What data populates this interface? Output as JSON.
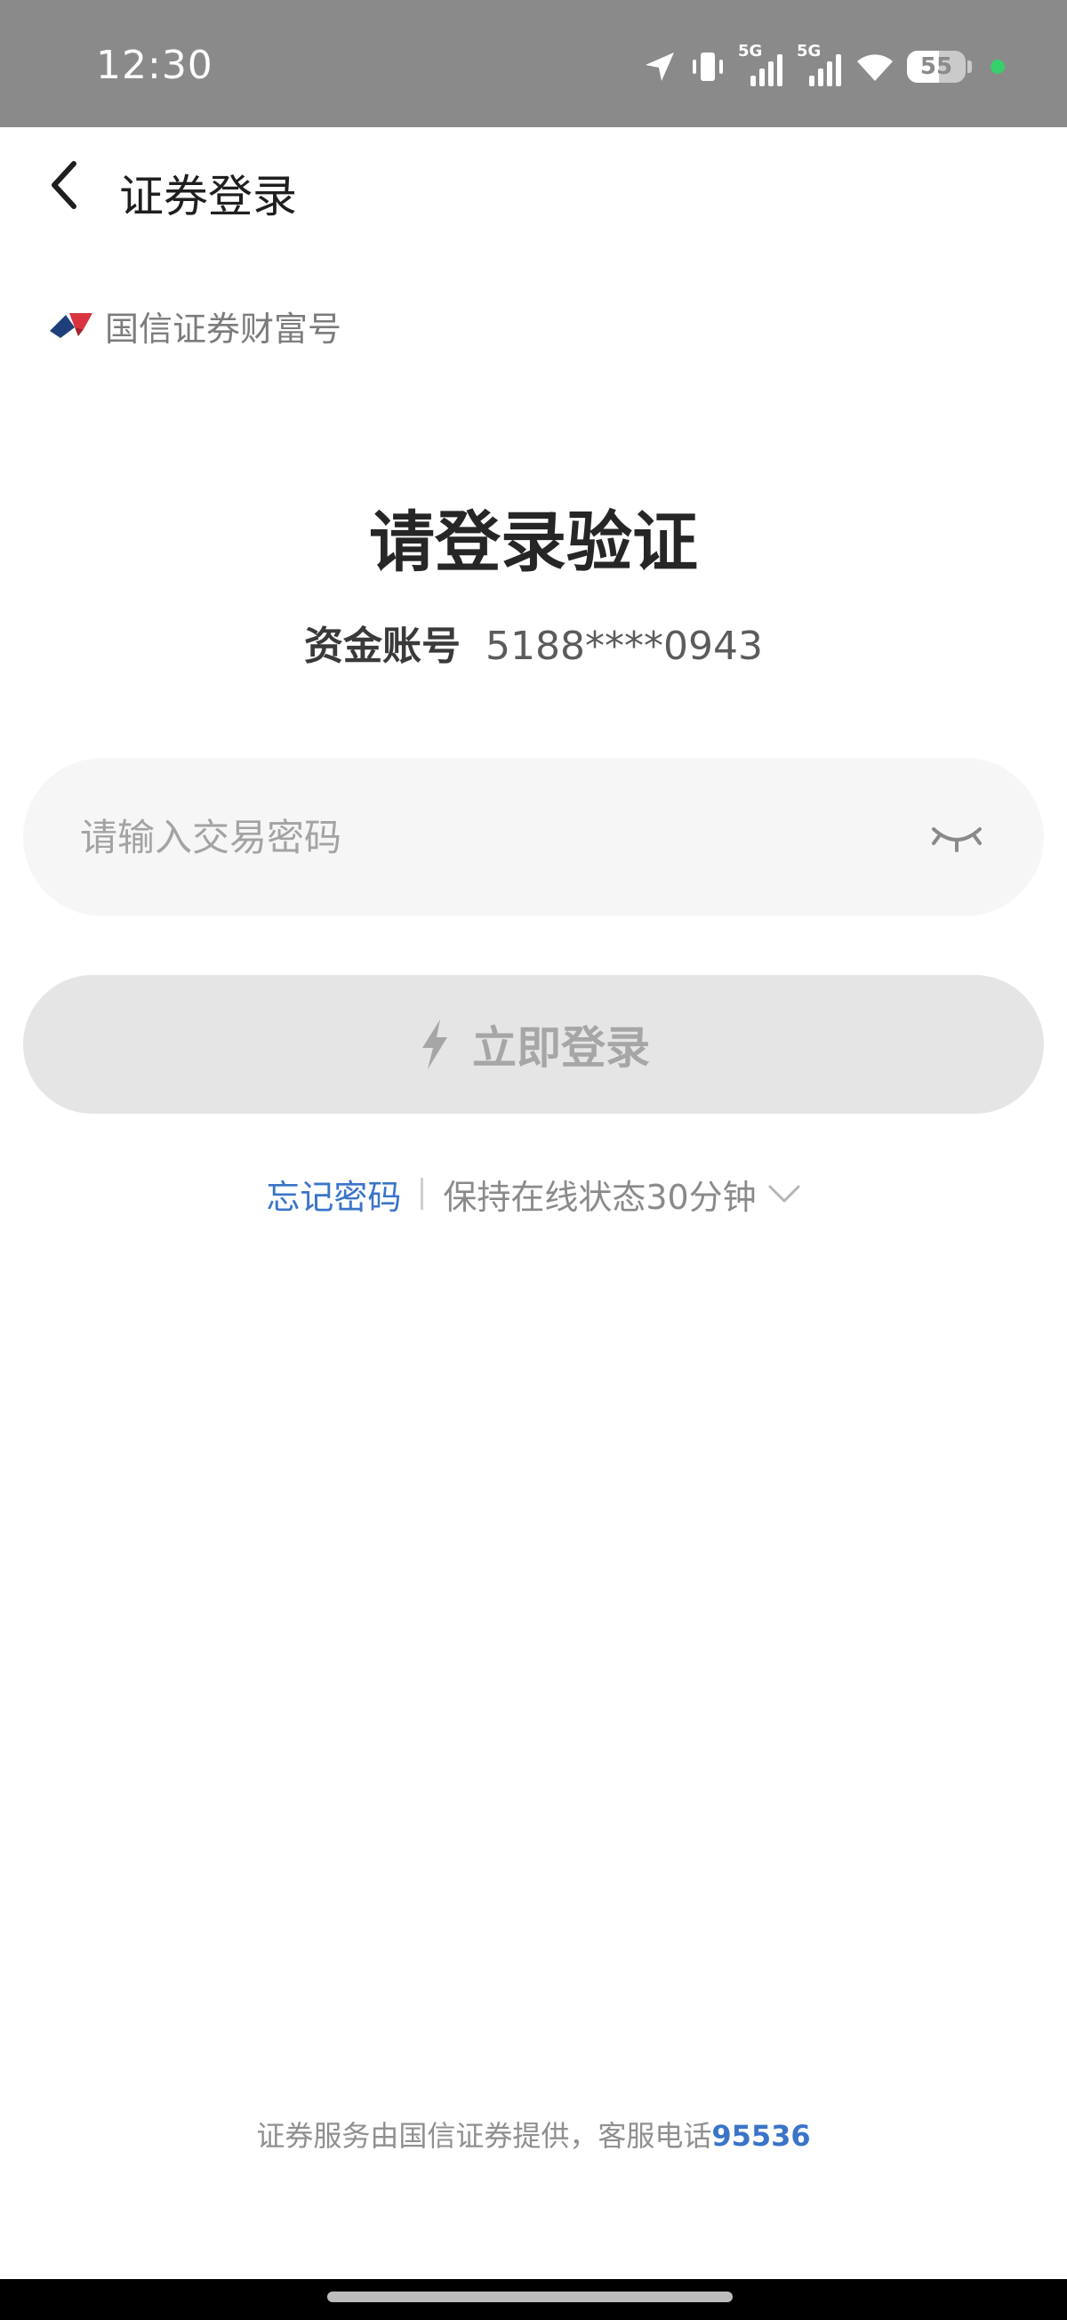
{
  "status_bar": {
    "time": "12:30",
    "battery": "55",
    "battery_level": 0.55,
    "network_1": "5G",
    "network_2": "5G"
  },
  "header": {
    "title": "证券登录"
  },
  "brand": {
    "name": "国信证券财富号"
  },
  "main": {
    "heading": "请登录验证",
    "account_label": "资金账号",
    "account_value": "5188****0943",
    "password_placeholder": "请输入交易密码",
    "login_label": "立即登录",
    "forgot_label": "忘记密码",
    "online_label": "保持在线状态30分钟"
  },
  "footer": {
    "note": "证券服务由国信证券提供，客服电话",
    "phone": "95536"
  },
  "colors": {
    "link": "#3a74c9",
    "button_disabled": "#e5e5e5",
    "input_bg": "#f6f6f6",
    "status_bar": "#8a8a8a"
  }
}
